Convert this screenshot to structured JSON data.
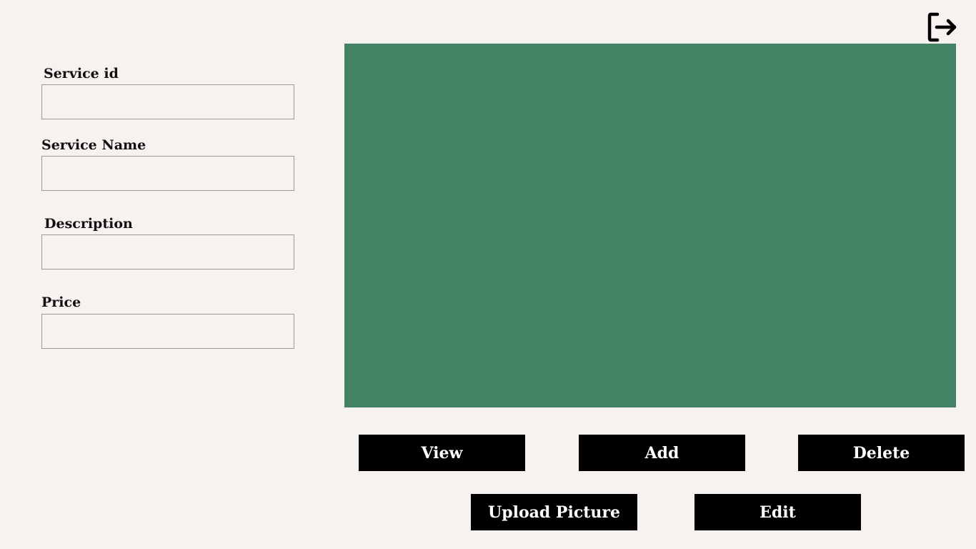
{
  "header": {
    "logout_icon": "logout-icon"
  },
  "form": {
    "service_id": {
      "label": "Service id",
      "value": "",
      "placeholder": ""
    },
    "service_name": {
      "label": "Service Name",
      "value": "",
      "placeholder": ""
    },
    "description": {
      "label": "Description",
      "value": "",
      "placeholder": ""
    },
    "price": {
      "label": "Price",
      "value": "",
      "placeholder": ""
    }
  },
  "preview": {
    "color": "#448266"
  },
  "buttons": {
    "view": "View",
    "add": "Add",
    "delete": "Delete",
    "upload_picture": "Upload Picture",
    "edit": "Edit"
  },
  "colors": {
    "background": "#f7f1f0",
    "button_bg": "#000000",
    "button_text": "#ffffff",
    "panel": "#448266"
  }
}
